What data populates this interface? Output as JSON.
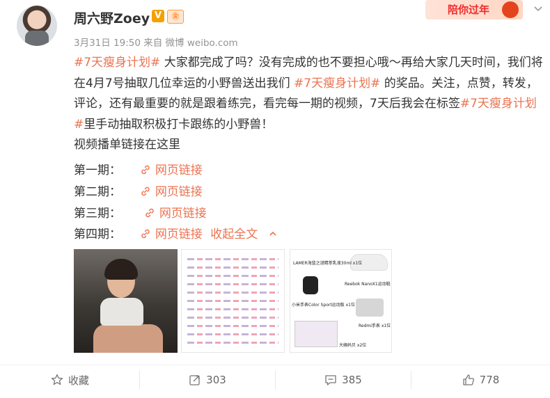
{
  "header": {
    "username": "周六野Zoey",
    "verified_badge": "V",
    "fan_badge": "㊎",
    "timestamp": "3月31日 19:50",
    "source": "来自 微博 weibo.com",
    "promo_text": "陪你过年",
    "more_icon": "chevron-down-icon"
  },
  "post": {
    "topic": "#7天瘦身计划#",
    "seg1": " 大家都完成了吗？没有完成的也不要担心哦～再给大家几天时间，我们将在4月7号抽取几位幸运的小野兽送出我们 ",
    "seg2": " 的奖品。关注，点赞，转发，评论，还有最重要的就是跟着练完，看完每一期的视频，7天后我会在标签",
    "seg3": "里手动抽取积极打卡跟练的小野兽！",
    "playlist_line": "视频播单链接在这里",
    "issues": [
      {
        "label": "第一期：",
        "link": "网页链接"
      },
      {
        "label": "第二期：",
        "link": "网页链接"
      },
      {
        "label": "第三期：",
        "link": "网页链接"
      },
      {
        "label": "第四期：",
        "link": "网页链接"
      }
    ],
    "collapse": "收起全文"
  },
  "images": {
    "prize_labels": [
      "LAMER海蓝之谜精萃乳液30ml x1位",
      "Reebok NanoX1运动鞋 x3位",
      "小米手表Color Sport运动版 x1位",
      "Redmi手表 x1位",
      "大姨妈贝 x2位"
    ]
  },
  "actions": {
    "favorite": "收藏",
    "repost": "303",
    "comment": "385",
    "like": "778"
  },
  "colors": {
    "accent": "#eb7350",
    "text": "#333333",
    "meta": "#939393"
  }
}
